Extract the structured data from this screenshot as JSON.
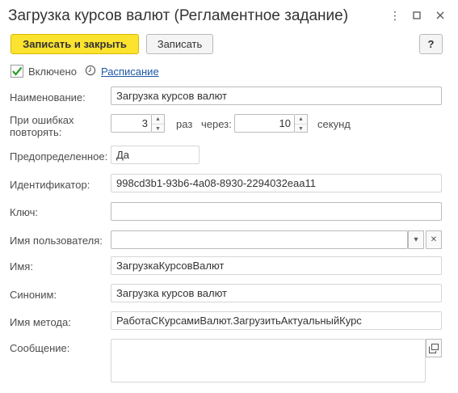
{
  "window": {
    "title": "Загрузка курсов валют (Регламентное задание)"
  },
  "toolbar": {
    "save_close_label": "Записать и закрыть",
    "save_label": "Записать",
    "help_label": "?"
  },
  "enabled": {
    "label": "Включено",
    "checked": true
  },
  "schedule_link": "Расписание",
  "fields": {
    "name": {
      "label": "Наименование:",
      "value": "Загрузка курсов валют"
    },
    "retry": {
      "label": "При ошибках повторять:",
      "times": "3",
      "times_suffix": "раз",
      "interval_label": "через:",
      "interval": "10",
      "interval_suffix": "секунд"
    },
    "predefined": {
      "label": "Предопределенное:",
      "value": "Да"
    },
    "identifier": {
      "label": "Идентификатор:",
      "value": "998cd3b1-93b6-4a08-8930-2294032eaa11"
    },
    "key": {
      "label": "Ключ:",
      "value": ""
    },
    "user_name": {
      "label": "Имя пользователя:",
      "value": ""
    },
    "name2": {
      "label": "Имя:",
      "value": "ЗагрузкаКурсовВалют"
    },
    "synonym": {
      "label": "Синоним:",
      "value": "Загрузка курсов валют"
    },
    "method": {
      "label": "Имя метода:",
      "value": "РаботаСКурсамиВалют.ЗагрузитьАктуальныйКурс"
    },
    "message": {
      "label": "Сообщение:",
      "value": ""
    }
  },
  "icons": {
    "more": "more-vert-icon",
    "maximize": "maximize-icon",
    "close": "close-icon",
    "schedule": "clock-icon",
    "dropdown": "dropdown-icon",
    "clear": "clear-icon",
    "expand": "open-window-icon"
  },
  "colors": {
    "primary_button": "#fbe32f",
    "link": "#1e57a6",
    "checkbox_check": "#2a9d2a"
  }
}
